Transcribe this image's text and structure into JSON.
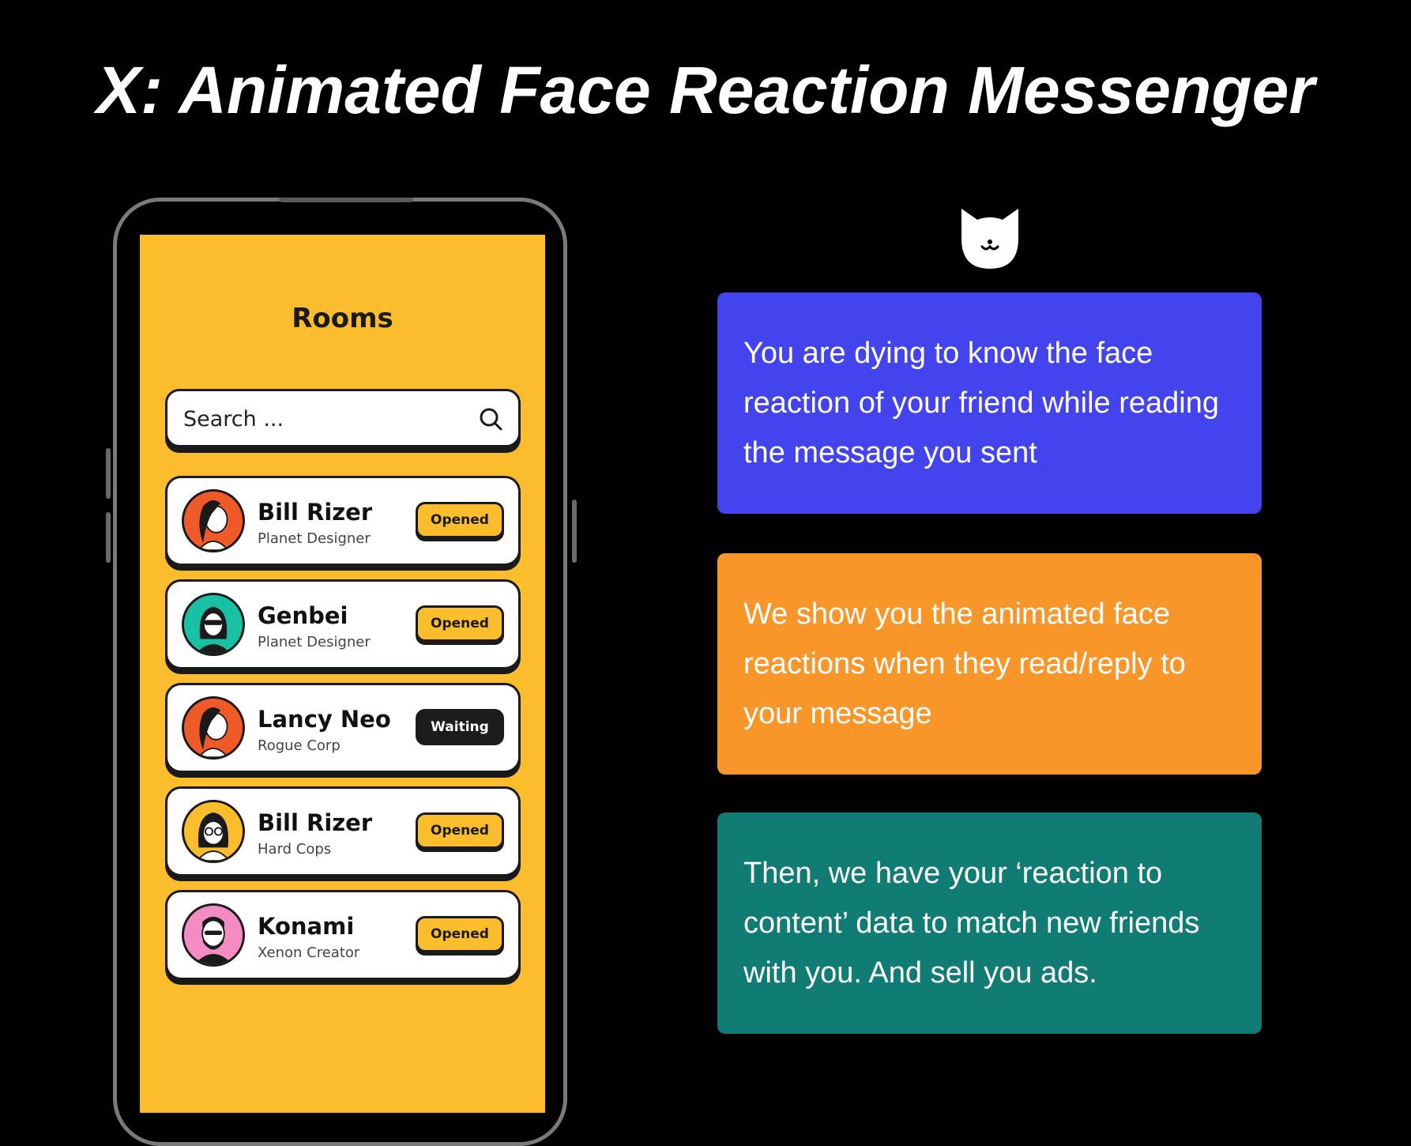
{
  "page": {
    "title": "X: Animated Face Reaction Messenger"
  },
  "app": {
    "screen_title": "Rooms",
    "search": {
      "placeholder": "Search ..."
    },
    "rooms": [
      {
        "name": "Bill Rizer",
        "subtitle": "Planet Designer",
        "status": "Opened",
        "avatar_color": "#f05a28"
      },
      {
        "name": "Genbei",
        "subtitle": "Planet Designer",
        "status": "Opened",
        "avatar_color": "#19c1a4"
      },
      {
        "name": "Lancy Neo",
        "subtitle": "Rogue Corp",
        "status": "Waiting",
        "avatar_color": "#f05a28"
      },
      {
        "name": "Bill Rizer",
        "subtitle": "Hard Cops",
        "status": "Opened",
        "avatar_color": "#fbbd2b"
      },
      {
        "name": "Konami",
        "subtitle": "Xenon Creator",
        "status": "Opened",
        "avatar_color": "#f48cc3"
      }
    ]
  },
  "cards": [
    {
      "text": "You are dying to know the face reaction of your friend while reading the message you sent",
      "color": "#4444ee"
    },
    {
      "text": "We show you the animated face reactions when they read/reply to your message",
      "color": "#f9962a"
    },
    {
      "text": "Then, we have your ‘reaction to content’ data to match new friends with you. And sell you ads.",
      "color": "#107c74"
    }
  ],
  "colors": {
    "screen_bg": "#fbbd2b",
    "page_bg": "#000000"
  },
  "icons": {
    "logo": "cat-face-icon",
    "search": "search-icon"
  }
}
